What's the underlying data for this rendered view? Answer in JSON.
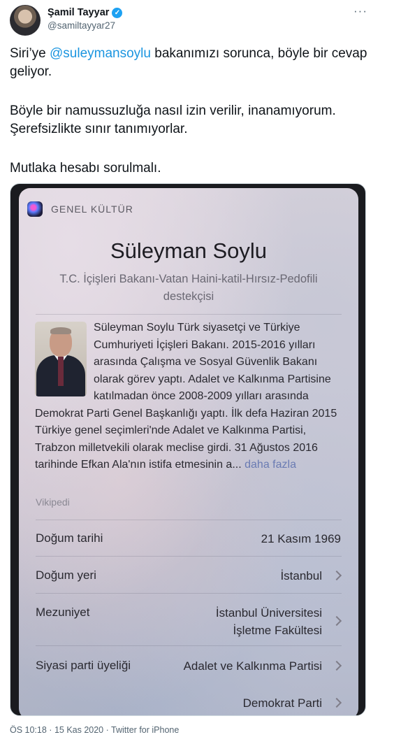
{
  "author": {
    "name": "Şamil Tayyar",
    "handle": "@samiltayyar27",
    "verified_icon": "✓"
  },
  "more_icon": "···",
  "tweet": {
    "p1_pre": "Siri’ye ",
    "p1_mention": "@suleymansoylu",
    "p1_post": " bakanımızı sorunca, böyle bir cevap geliyor.",
    "p2": "Böyle bir namussuzluğa nasıl izin verilir, inanamıyorum. Şerefsizlikte sınır tanımıyorlar.",
    "p3": "Mutlaka hesabı sorulmalı."
  },
  "siri": {
    "category": "GENEL KÜLTÜR",
    "title": "Süleyman Soylu",
    "subtitle": "T.C. İçişleri Bakanı-Vatan Haini-katil-Hırsız-Pedofili destekçisi",
    "summary": "Süleyman Soylu Türk siyasetçi ve Türkiye Cumhuriyeti İçişleri Bakanı. 2015-2016 yılları arasında Çalışma ve Sosyal Güvenlik Bakanı olarak görev yaptı. Adalet ve Kalkınma Partisine katılmadan önce 2008-2009 yılları arasında Demokrat Parti Genel Başkanlığı yaptı. İlk defa Haziran 2015 Türkiye genel seçimleri'nde Adalet ve Kalkınma Partisi, Trabzon milletvekili olarak meclise girdi. 31 Ağustos 2016 tarihinde Efkan Ala'nın istifa etmesinin a...",
    "more_label": "daha fazla",
    "source": "Vikipedi",
    "rows": [
      {
        "label": "Doğum tarihi",
        "value": "21 Kasım 1969"
      },
      {
        "label": "Doğum yeri",
        "value": "İstanbul"
      },
      {
        "label": "Mezuniyet",
        "value_line1": "İstanbul Üniversitesi",
        "value_line2": "İşletme Fakültesi"
      },
      {
        "label": "Siyasi parti üyeliği",
        "value": "Adalet ve Kalkınma Partisi"
      },
      {
        "label": "",
        "value": "Demokrat Parti"
      }
    ]
  },
  "meta": {
    "time": "ÖS 10:18",
    "separator": " · ",
    "date": "15 Kas 2020",
    "via": "Twitter for iPhone"
  },
  "colors": {
    "link": "#1b95e0",
    "verified": "#1da1f2",
    "secondary_text": "#536471"
  }
}
